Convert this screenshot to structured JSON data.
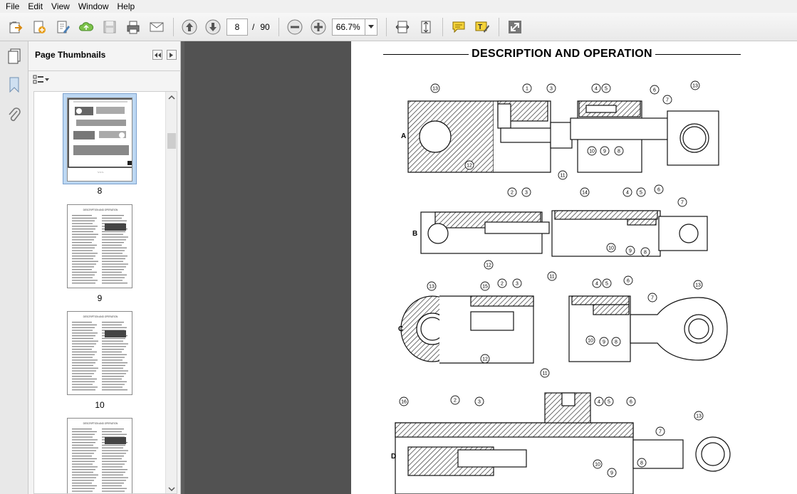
{
  "menu": [
    "File",
    "Edit",
    "View",
    "Window",
    "Help"
  ],
  "toolbar": {
    "page_current": "8",
    "page_separator": "/",
    "page_total": "90",
    "zoom": "66.7%"
  },
  "panel": {
    "title": "Page Thumbnails",
    "thumbnails": [
      {
        "label": "8",
        "heading": "DESCRIPTION AND OPERATION"
      },
      {
        "label": "9",
        "heading": "DESCRIPTION AND OPERATION"
      },
      {
        "label": "10",
        "heading": "DESCRIPTION AND OPERATION"
      },
      {
        "label": "",
        "heading": "DESCRIPTION AND OPERATION"
      }
    ]
  },
  "document": {
    "heading": "DESCRIPTION AND OPERATION",
    "figure_letters": [
      "A",
      "B",
      "C",
      "D"
    ],
    "callouts": {
      "a": [
        "13",
        "1",
        "3",
        "4",
        "5",
        "6",
        "7",
        "13",
        "12",
        "11",
        "10",
        "9",
        "8"
      ],
      "b": [
        "2",
        "3",
        "14",
        "4",
        "5",
        "6",
        "7",
        "12",
        "11",
        "10",
        "9",
        "8"
      ],
      "c": [
        "13",
        "15",
        "2",
        "3",
        "4",
        "5",
        "6",
        "7",
        "13",
        "12",
        "11",
        "10",
        "9",
        "8"
      ],
      "d": [
        "16",
        "2",
        "3",
        "4",
        "5",
        "6",
        "7",
        "13",
        "10",
        "9",
        "8"
      ]
    }
  },
  "colors": {
    "menubar_bg": "#f0f0f0",
    "doc_bg": "#525252",
    "selection": "#bcd7f2"
  }
}
